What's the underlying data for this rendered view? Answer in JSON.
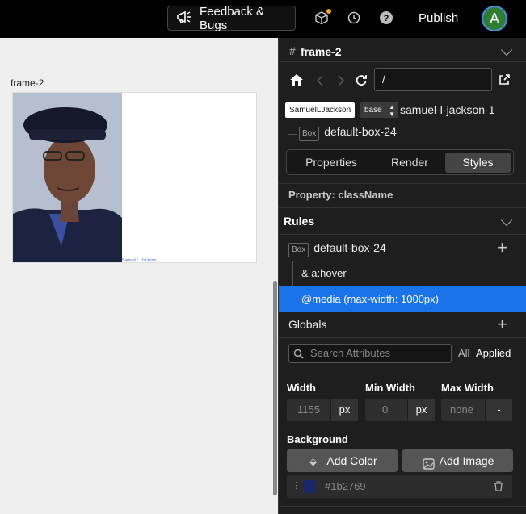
{
  "topbar": {
    "feedback_label": "Feedback & Bugs",
    "publish_label": "Publish",
    "avatar_initial": "A",
    "icons": [
      "megaphone-icon",
      "cube-icon",
      "history-icon",
      "help-icon"
    ]
  },
  "canvas": {
    "frame_label": "frame-2",
    "caption": "Samuel L. Jackson"
  },
  "panel": {
    "frame_title": "frame-2",
    "url_value": "/",
    "component_tag": "SamuelLJackson",
    "variant": "base",
    "component_name": "samuel-l-jackson-1",
    "child_chip": "Box",
    "child_name": "default-box-24",
    "tabs": [
      "Properties",
      "Render",
      "Styles"
    ],
    "active_tab": "Styles",
    "property_label": "Property: className",
    "rules_heading": "Rules",
    "rules": {
      "box_chip": "Box",
      "box_name": "default-box-24",
      "hover": "& a:hover",
      "media": "@media (max-width: 1000px)"
    },
    "globals_heading": "Globals",
    "search_placeholder": "Search Attributes",
    "filter_all": "All",
    "filter_applied": "Applied",
    "width": {
      "label": "Width",
      "value": "1155",
      "unit": "px"
    },
    "min_width": {
      "label": "Min Width",
      "value": "0",
      "unit": "px"
    },
    "max_width": {
      "label": "Max Width",
      "value": "none",
      "unit": "-"
    },
    "background_heading": "Background",
    "add_color": "Add Color",
    "add_image": "Add Image",
    "color_value": "#1b2769",
    "colors": {
      "swatch": "#1b2769",
      "media_highlight": "#1a73e8",
      "panel_bg": "#1e1e1e"
    }
  }
}
